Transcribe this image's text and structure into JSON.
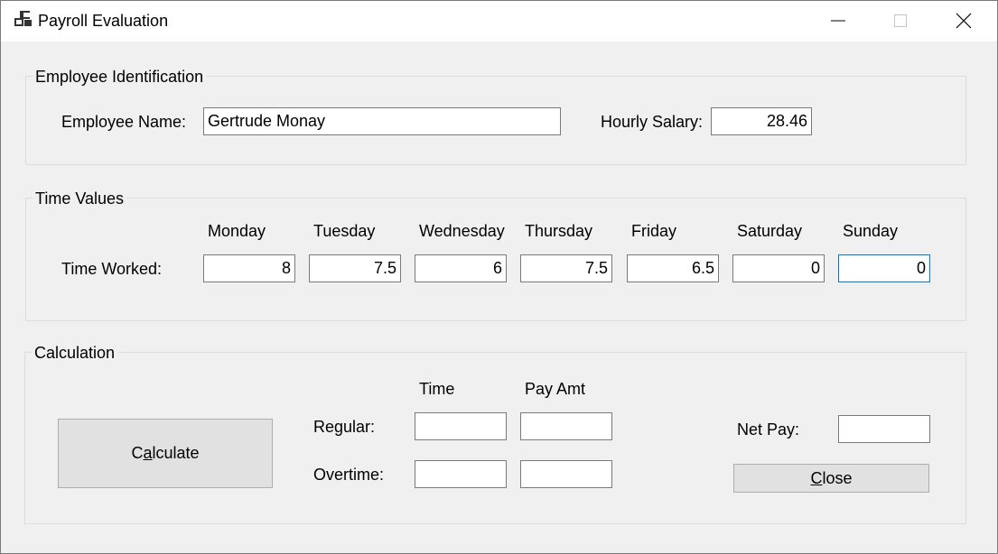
{
  "window": {
    "title": "Payroll Evaluation"
  },
  "identification": {
    "group_label": "Employee Identification",
    "name_label": "Employee Name:",
    "name_value": "Gertrude Monay",
    "salary_label": "Hourly Salary:",
    "salary_value": "28.46"
  },
  "time_values": {
    "group_label": "Time Values",
    "row_label": "Time Worked:",
    "days": [
      {
        "label": "Monday",
        "value": "8"
      },
      {
        "label": "Tuesday",
        "value": "7.5"
      },
      {
        "label": "Wednesday",
        "value": "6"
      },
      {
        "label": "Thursday",
        "value": "7.5"
      },
      {
        "label": "Friday",
        "value": "6.5"
      },
      {
        "label": "Saturday",
        "value": "0"
      },
      {
        "label": "Sunday",
        "value": "0"
      }
    ]
  },
  "calculation": {
    "group_label": "Calculation",
    "calculate_button": {
      "before": "C",
      "mnemonic": "a",
      "after": "lculate"
    },
    "time_header": "Time",
    "pay_header": "Pay Amt",
    "regular_label": "Regular:",
    "overtime_label": "Overtime:",
    "regular_time": "",
    "regular_pay": "",
    "overtime_time": "",
    "overtime_pay": "",
    "net_pay_label": "Net Pay:",
    "net_pay": "",
    "close_button": {
      "mnemonic": "C",
      "after": "lose"
    }
  }
}
